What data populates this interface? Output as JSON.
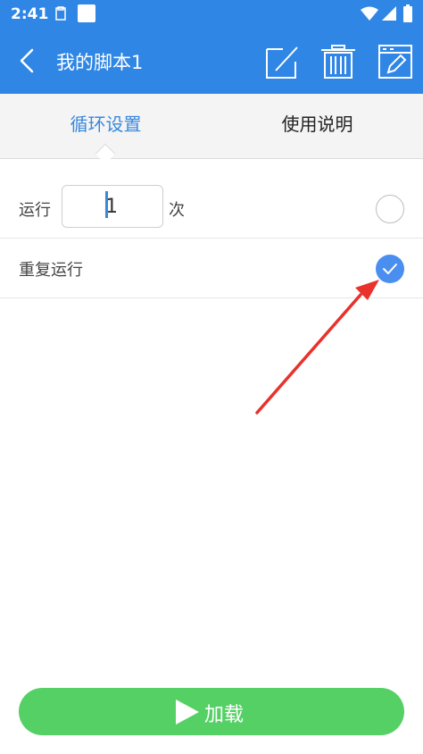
{
  "status_bar": {
    "time": "2:41"
  },
  "app_bar": {
    "title": "我的脚本1"
  },
  "tabs": [
    {
      "label": "循环设置",
      "active": true
    },
    {
      "label": "使用说明",
      "active": false
    }
  ],
  "loop_settings": {
    "run_prefix": "运行",
    "run_count_value": "1",
    "run_suffix": "次",
    "run_count_selected": false,
    "repeat_label": "重复运行",
    "repeat_selected": true
  },
  "load_button": {
    "label": "加载"
  },
  "colors": {
    "primary": "#2f86e5",
    "tab_active": "#3a88dc",
    "radio_checked": "#4a8ef0",
    "load_button": "#55d065",
    "annotation_arrow": "#e8322b"
  }
}
